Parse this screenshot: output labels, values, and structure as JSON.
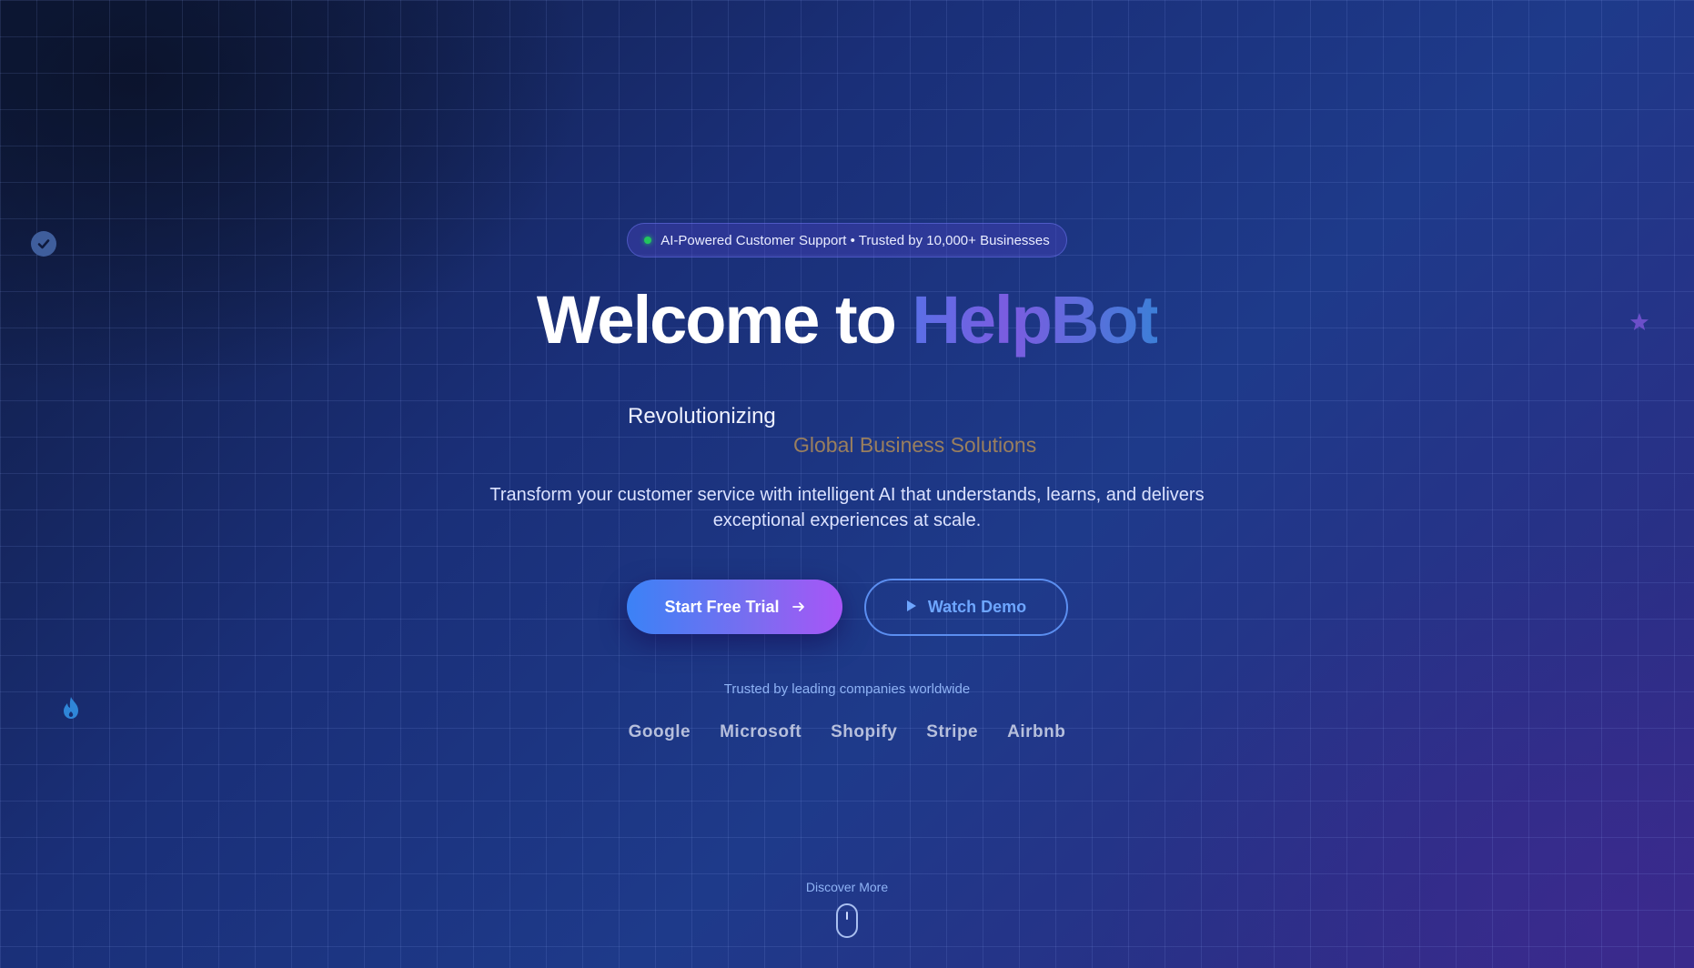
{
  "badge": {
    "text": "AI-Powered Customer Support • Trusted by 10,000+ Businesses",
    "status_color": "#22c55e"
  },
  "hero": {
    "title_prefix": "Welcome to ",
    "title_brand": "HelpBot",
    "rotating_lead": "Revolutionizing",
    "rotating_phrase": "Global Business Solutions",
    "description": "Transform your customer service with intelligent AI that understands, learns, and delivers exceptional experiences at scale."
  },
  "cta": {
    "primary_label": "Start Free Trial",
    "primary_icon": "arrow-right-icon",
    "secondary_label": "Watch Demo",
    "secondary_icon": "play-icon"
  },
  "trust": {
    "caption": "Trusted by leading companies worldwide",
    "companies": [
      "Google",
      "Microsoft",
      "Shopify",
      "Stripe",
      "Airbnb"
    ]
  },
  "scroll": {
    "label": "Discover More",
    "icon": "mouse-scroll-icon"
  },
  "decorations": [
    "check-circle-icon",
    "star-icon",
    "flame-icon"
  ],
  "colors": {
    "brand_gradient_start": "#3b82f6",
    "brand_gradient_end": "#a855f7",
    "accent_blue": "#6ea6ff"
  }
}
